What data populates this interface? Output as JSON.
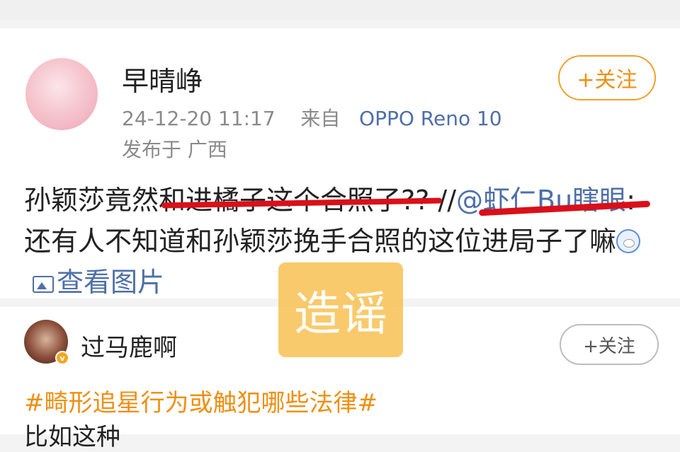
{
  "post": {
    "username": "早晴峥",
    "time": "24-12-20 11:17",
    "source_prefix": "来自",
    "device": "OPPO Reno 10",
    "location": "发布于 广西",
    "follow_label": "+关注",
    "text_main": "孙颖莎竟然和进橘子这个合照了?? //",
    "mention": "@虾仁Bu瞎眼",
    "text_rest": ":还有人不知道和孙颖莎挽手合照的这位进局子了嘛",
    "emoji": "doraemon-emoji",
    "view_pic": "查看图片"
  },
  "comment": {
    "username": "过马鹿啊",
    "follow_label": "+关注",
    "badge": "v",
    "hashtag": "#畸形追星行为或触犯哪些法律#",
    "text": "比如这种"
  },
  "stamp_text": "造谣",
  "colors": {
    "follow_orange": "#ef8f12",
    "link_blue": "#4e6fa8",
    "underline_red": "#d9101a",
    "stamp_yellow": "#f8c660"
  }
}
